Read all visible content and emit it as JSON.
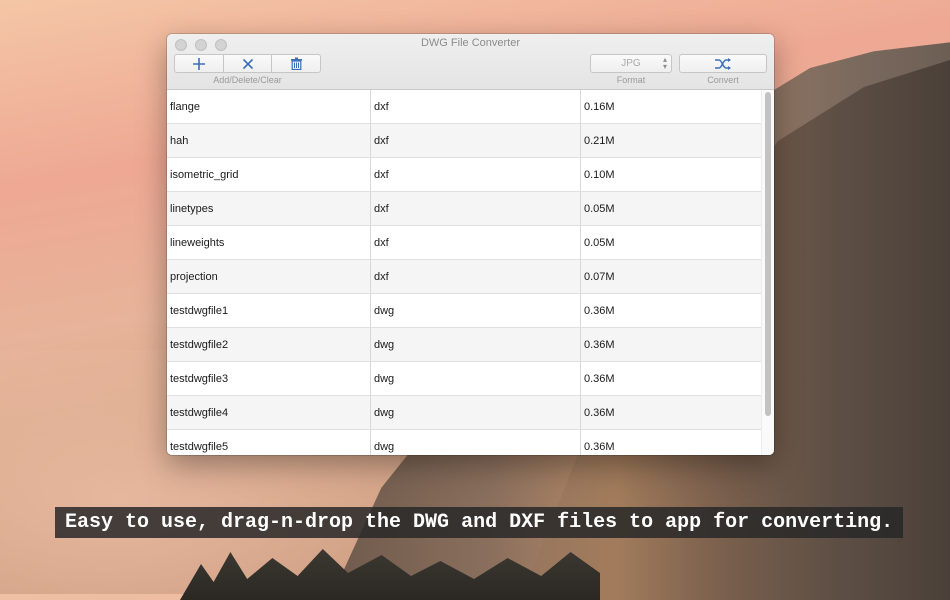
{
  "window": {
    "title": "DWG File Converter"
  },
  "toolbar": {
    "edit_group_label": "Add/Delete/Clear",
    "format_label": "Format",
    "format_value": "JPG",
    "convert_label": "Convert",
    "icons": {
      "add": "plus-icon",
      "delete": "x-icon",
      "clear": "trash-icon",
      "convert": "shuffle-icon"
    }
  },
  "files": [
    {
      "name": "flange",
      "type": "dxf",
      "size": "0.16M"
    },
    {
      "name": "hah",
      "type": "dxf",
      "size": "0.21M"
    },
    {
      "name": "isometric_grid",
      "type": "dxf",
      "size": "0.10M"
    },
    {
      "name": "linetypes",
      "type": "dxf",
      "size": "0.05M"
    },
    {
      "name": "lineweights",
      "type": "dxf",
      "size": "0.05M"
    },
    {
      "name": "projection",
      "type": "dxf",
      "size": "0.07M"
    },
    {
      "name": "testdwgfile1",
      "type": "dwg",
      "size": "0.36M"
    },
    {
      "name": "testdwgfile2",
      "type": "dwg",
      "size": "0.36M"
    },
    {
      "name": "testdwgfile3",
      "type": "dwg",
      "size": "0.36M"
    },
    {
      "name": "testdwgfile4",
      "type": "dwg",
      "size": "0.36M"
    },
    {
      "name": "testdwgfile5",
      "type": "dwg",
      "size": "0.36M"
    }
  ],
  "caption": "Easy to use, drag-n-drop the DWG and DXF files to app for converting.",
  "colors": {
    "accent": "#3c6fb8"
  }
}
